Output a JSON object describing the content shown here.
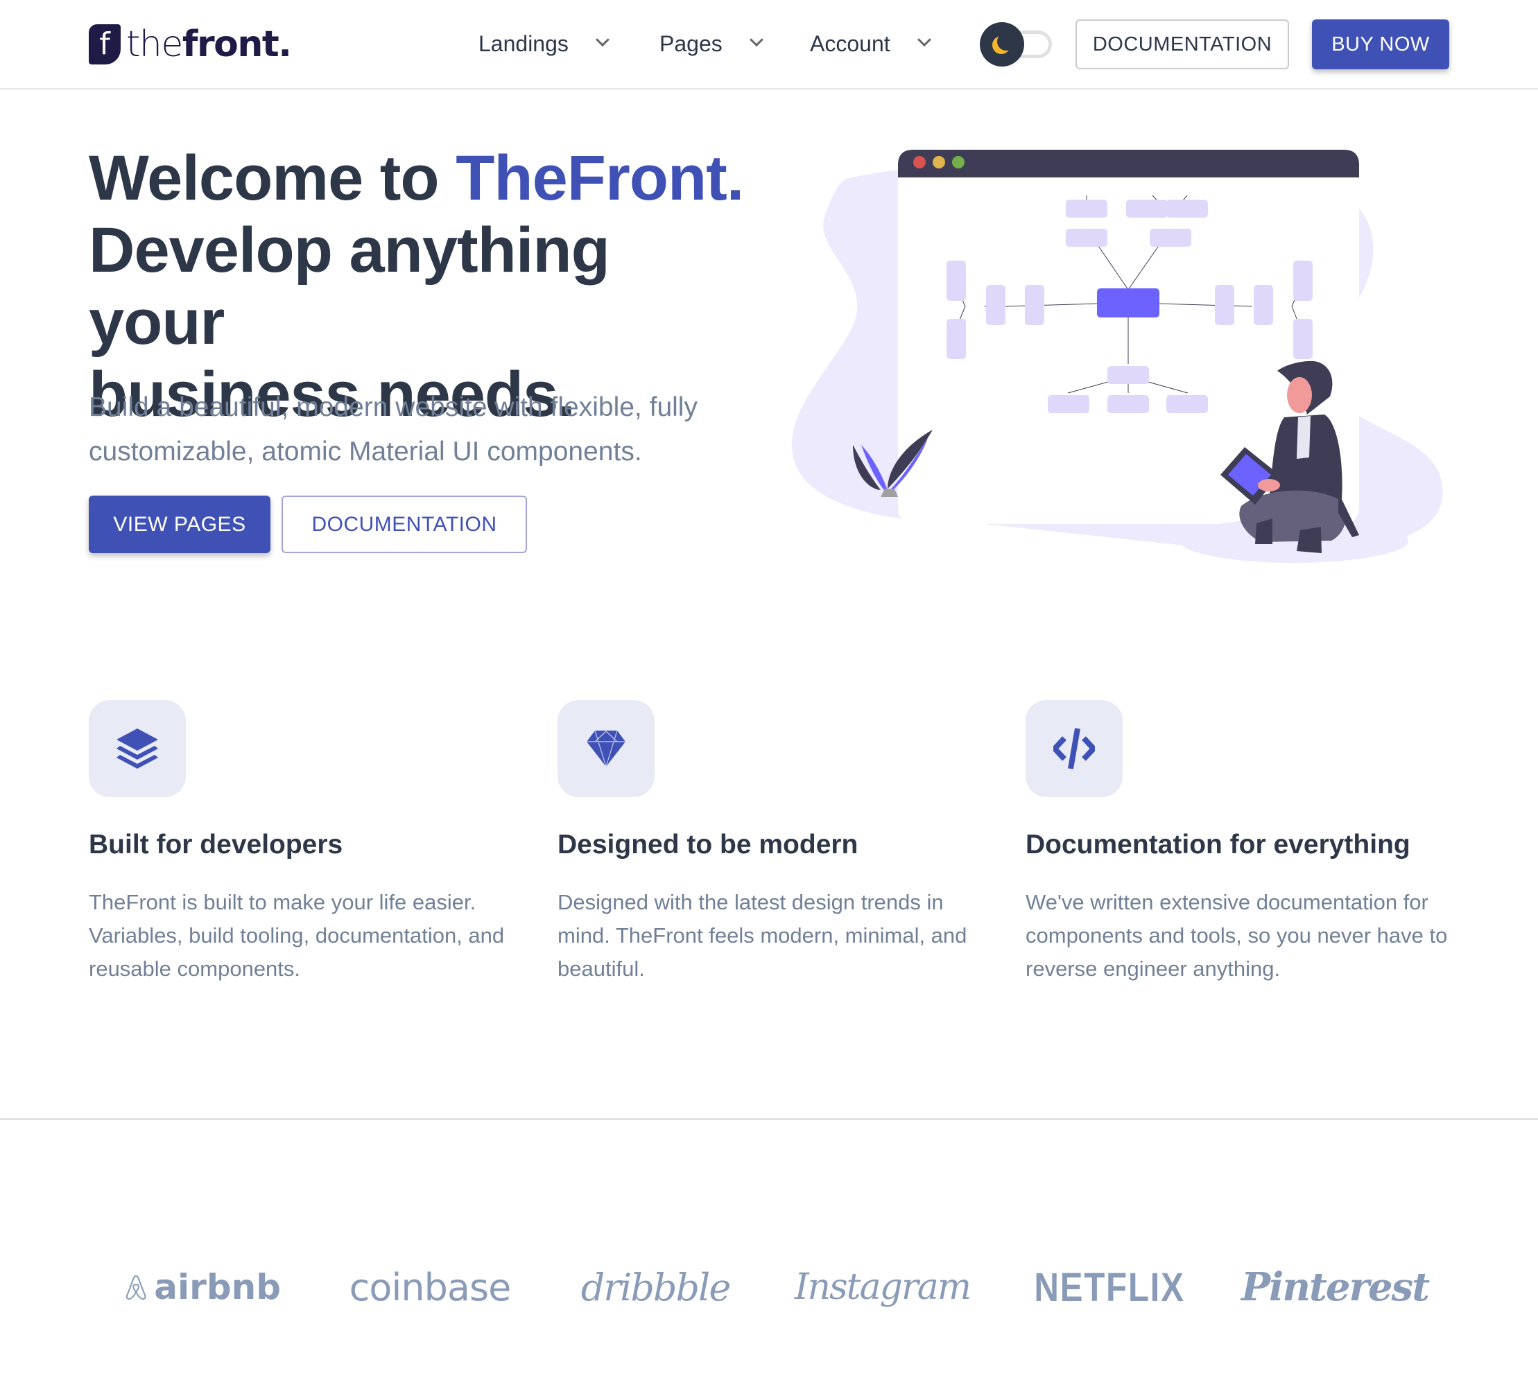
{
  "header": {
    "logo": {
      "mark": "f",
      "text_light": "the",
      "text_bold": "front."
    },
    "nav": [
      {
        "label": "Landings",
        "icon": "chevron-down-icon"
      },
      {
        "label": "Pages",
        "icon": "chevron-down-icon"
      },
      {
        "label": "Account",
        "icon": "chevron-down-icon"
      }
    ],
    "theme_toggle": {
      "mode": "dark",
      "icon": "moon-icon"
    },
    "documentation_label": "DOCUMENTATION",
    "buy_now_label": "BUY NOW"
  },
  "hero": {
    "title_prefix": "Welcome to ",
    "title_accent": "TheFront.",
    "title_line2": "Develop anything your",
    "title_line3": "business needs.",
    "subtitle": "Build a beautiful, modern website with flexible, fully customizable, atomic Material UI components.",
    "view_pages_label": "VIEW PAGES",
    "documentation_label": "DOCUMENTATION"
  },
  "features": [
    {
      "icon": "layers-icon",
      "title": "Built for developers",
      "body": "TheFront is built to make your life easier. Variables, build tooling, documentation, and reusable components."
    },
    {
      "icon": "diamond-icon",
      "title": "Designed to be modern",
      "body": "Designed with the latest design trends in mind. TheFront feels modern, minimal, and beautiful."
    },
    {
      "icon": "code-icon",
      "title": "Documentation for everything",
      "body": "We've written extensive documentation for components and tools, so you never have to reverse engineer anything."
    }
  ],
  "partners": [
    "airbnb",
    "coinbase",
    "dribbble",
    "Instagram",
    "NETFLIX",
    "Pinterest"
  ],
  "colors": {
    "primary": "#3f51b5",
    "text_dark": "#2d3748",
    "text_muted": "#718096",
    "icon_bg": "#e8eaf6",
    "logo_gray": "#8a9bb8",
    "illustration_bg": "#edeafd",
    "illustration_node": "#e0d8fa",
    "illustration_accent": "#6c63ff"
  }
}
